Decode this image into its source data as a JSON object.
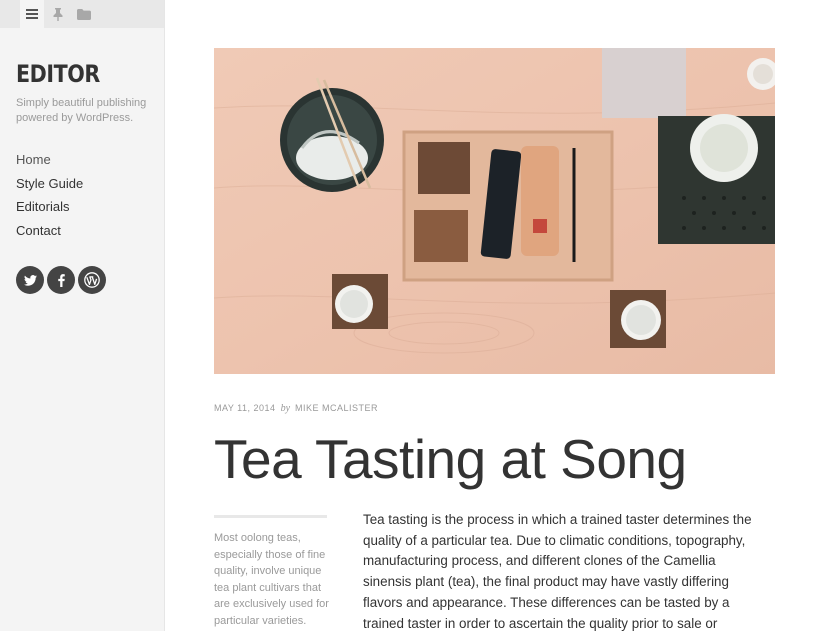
{
  "sidebar": {
    "tabs": [
      {
        "icon": "menu-icon",
        "active": true
      },
      {
        "icon": "pin-icon",
        "active": false
      },
      {
        "icon": "folder-icon",
        "active": false
      }
    ],
    "site_title": "EDITOR",
    "tagline": "Simply beautiful publishing powered by WordPress.",
    "nav": [
      {
        "label": "Home"
      },
      {
        "label": "Style Guide"
      },
      {
        "label": "Editorials"
      },
      {
        "label": "Contact"
      }
    ],
    "social": [
      {
        "icon": "twitter-icon"
      },
      {
        "icon": "facebook-icon"
      },
      {
        "icon": "wordpress-icon"
      }
    ]
  },
  "post": {
    "date": "MAY 11, 2014",
    "by": "by",
    "author": "MIKE MCALISTER",
    "title": "Tea Tasting at Song",
    "excerpt": "Most oolong teas, especially those of fine quality, involve unique tea plant cultivars that are exclusively used for particular varieties.",
    "body": "Tea tasting is the process in which a trained taster determines the quality of a particular tea. Due to climatic conditions, topography, manufacturing process, and different clones of the Camellia sinensis plant (tea), the final product may have vastly differing flavors and appearance. These differences can be tasted by a trained taster in order to ascertain the quality prior to sale or possibly blending tea."
  },
  "colors": {
    "sidebar_bg": "#f4f4f4",
    "text": "#333333",
    "muted": "#999999",
    "social_bg": "#444444"
  }
}
